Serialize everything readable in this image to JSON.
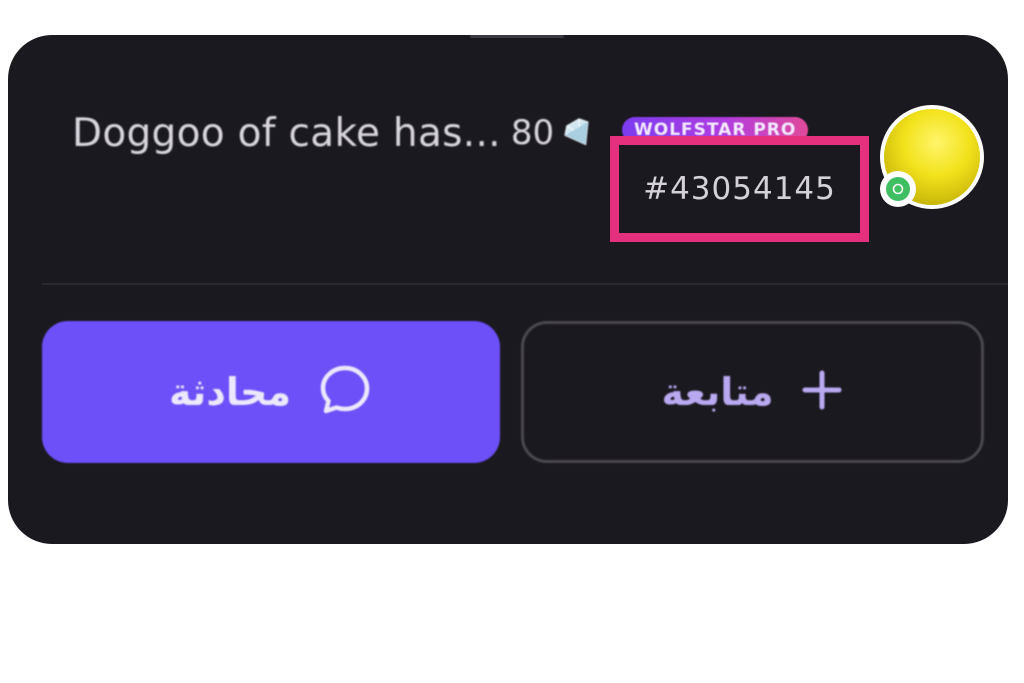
{
  "profile": {
    "username": "Doggoo of cake has...",
    "level": "80",
    "level_icon": "gem-icon",
    "badge": "WOLFSTAR PRO",
    "user_id": "#43054145",
    "online_icon": "online-status-icon"
  },
  "actions": {
    "chat_label": "محادثة",
    "chat_icon": "chat-bubble-icon",
    "follow_label": "متابعة",
    "follow_icon": "plus-icon"
  },
  "colors": {
    "card_bg": "#1b1920",
    "chat_button": "#6d50f7",
    "highlight_box": "#e5307d",
    "badge_gradient_start": "#7b3cf0",
    "badge_gradient_end": "#e14a9a"
  }
}
